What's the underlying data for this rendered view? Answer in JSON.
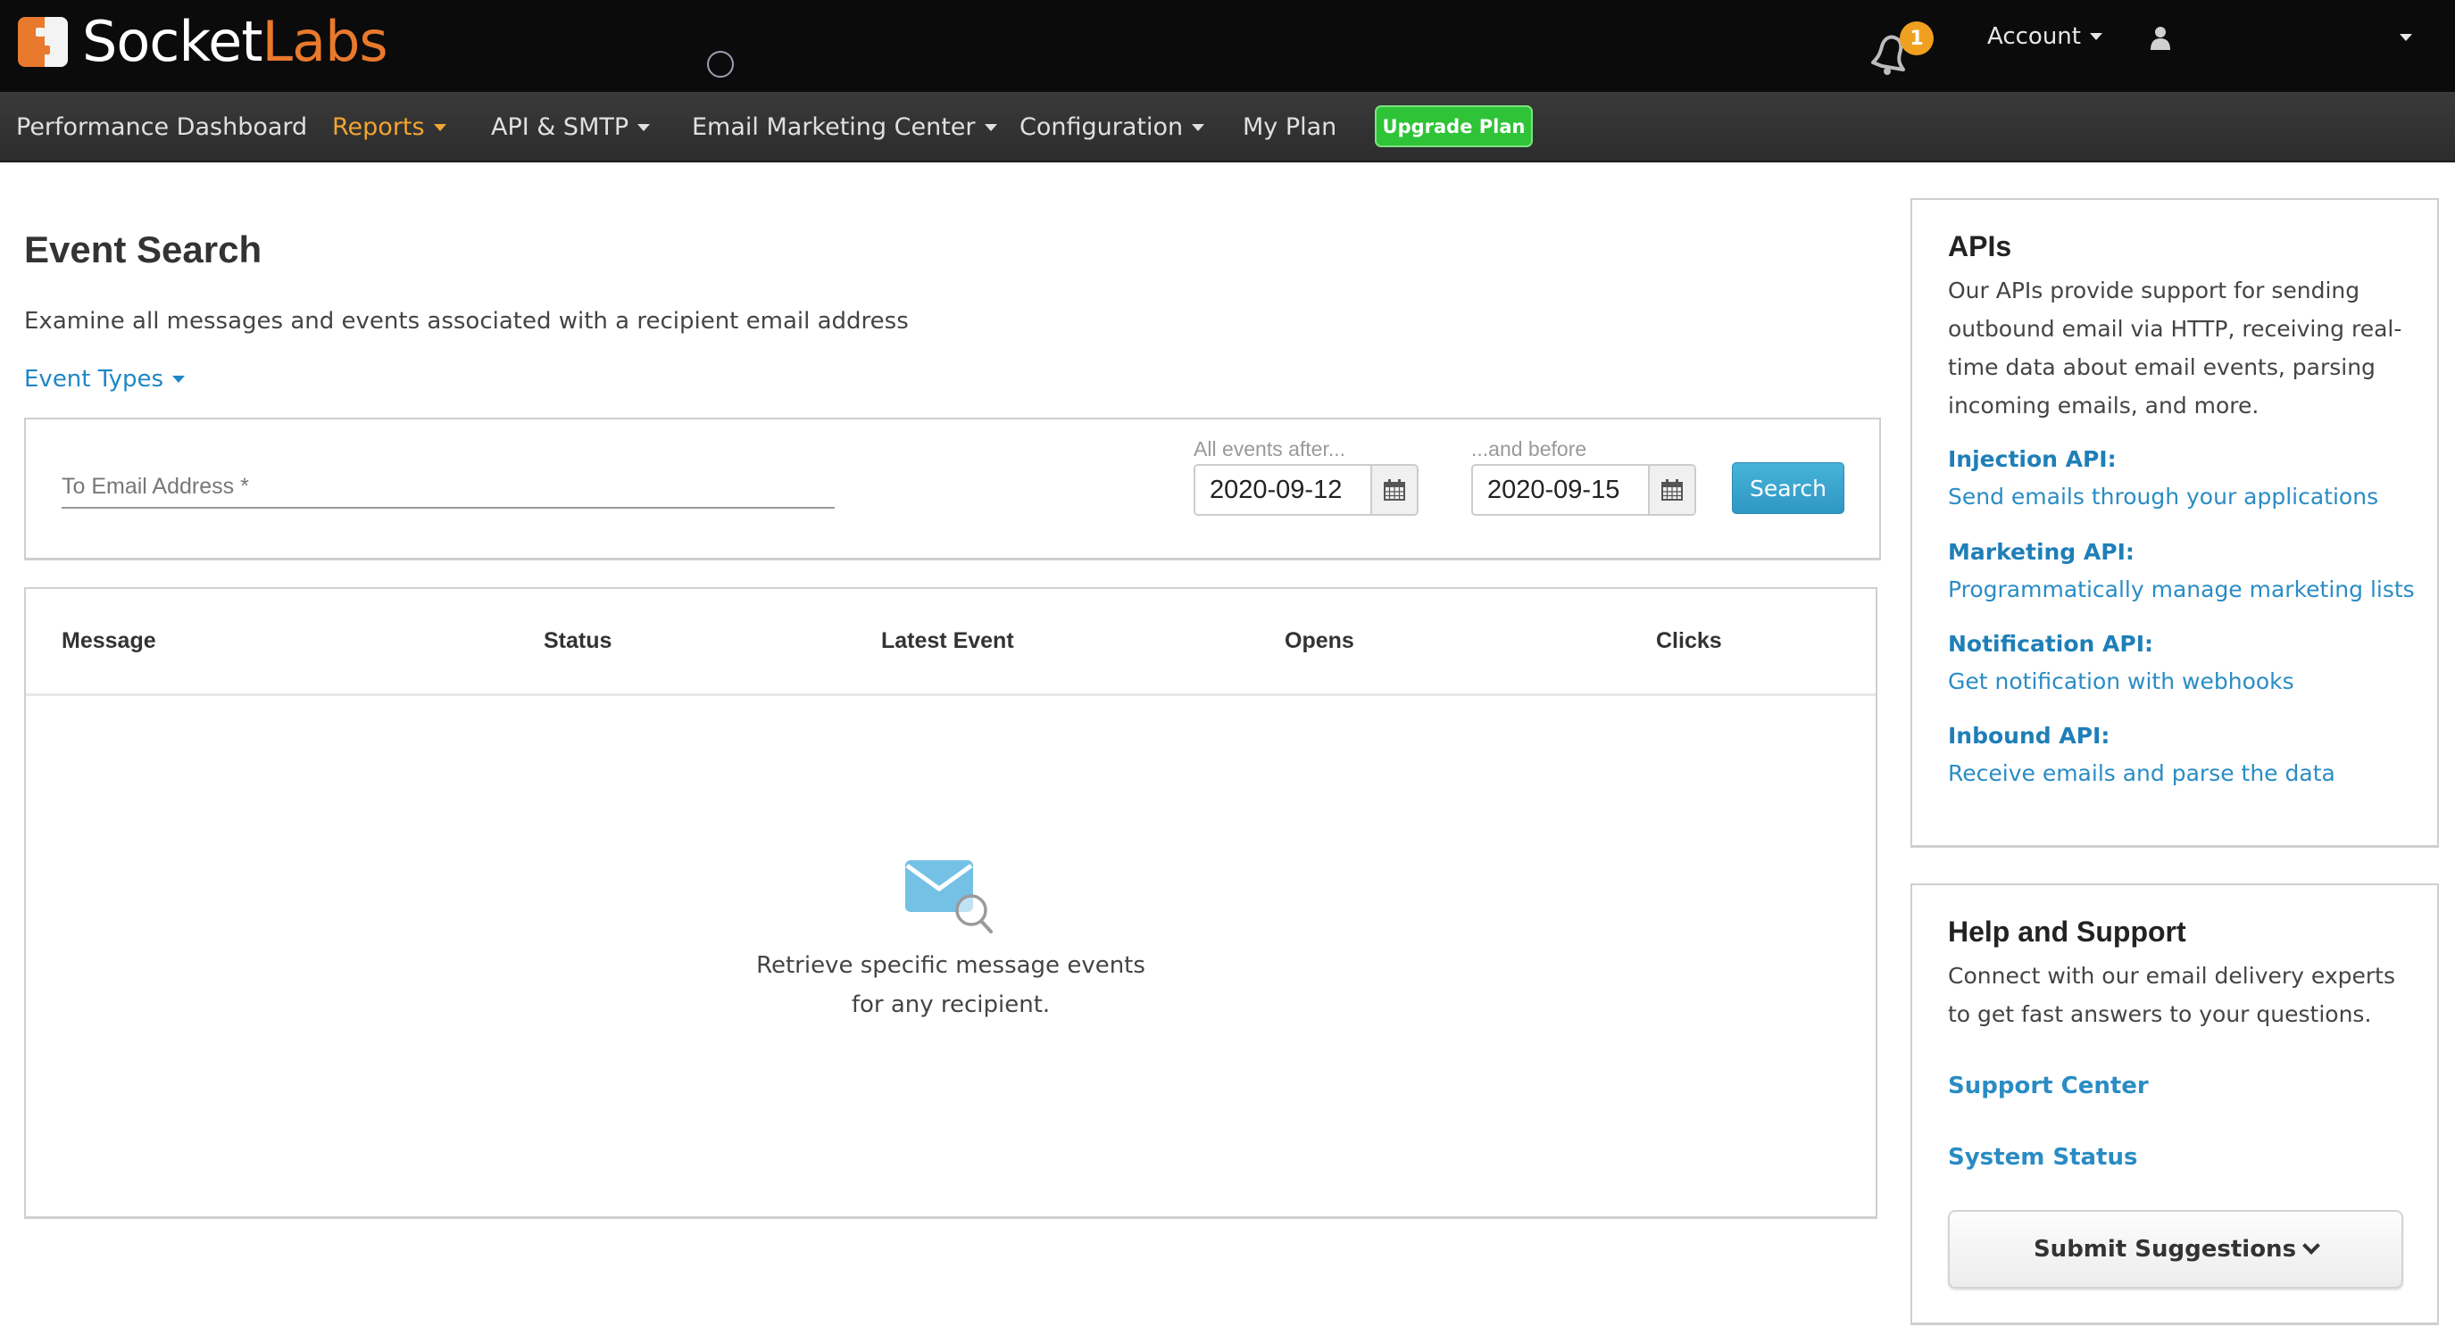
{
  "header": {
    "logo_primary": "Socket",
    "logo_secondary": "Labs",
    "notifications_count": "1",
    "account_label": "Account",
    "user_icon": "user-icon",
    "bell_icon": "bell-icon"
  },
  "nav": {
    "items": [
      {
        "label": "Performance Dashboard",
        "has_dropdown": false,
        "active": false
      },
      {
        "label": "Reports",
        "has_dropdown": true,
        "active": true
      },
      {
        "label": "API & SMTP",
        "has_dropdown": true,
        "active": false
      },
      {
        "label": "Email Marketing Center",
        "has_dropdown": true,
        "active": false
      },
      {
        "label": "Configuration",
        "has_dropdown": true,
        "active": false
      },
      {
        "label": "My Plan",
        "has_dropdown": false,
        "active": false
      }
    ],
    "upgrade_label": "Upgrade Plan"
  },
  "main": {
    "title": "Event Search",
    "description": "Examine all messages and events associated with a recipient email address",
    "event_types_label": "Event Types",
    "search": {
      "email_placeholder": "To Email Address *",
      "email_value": "",
      "after_label": "All events after...",
      "after_value": "2020-09-12",
      "before_label": "...and before",
      "before_value": "2020-09-15",
      "search_button": "Search"
    },
    "table": {
      "columns": [
        "Message",
        "Status",
        "Latest Event",
        "Opens",
        "Clicks"
      ],
      "rows": [],
      "empty_line1": "Retrieve specific message events",
      "empty_line2": "for any recipient."
    }
  },
  "sidebar": {
    "apis": {
      "title": "APIs",
      "description": "Our APIs provide support for sending outbound email via HTTP, receiving real-time data about email events, parsing incoming emails, and more.",
      "items": [
        {
          "heading": "Injection API:",
          "link": "Send emails through your applications"
        },
        {
          "heading": "Marketing API:",
          "link": "Programmatically manage marketing lists"
        },
        {
          "heading": "Notification API:",
          "link": "Get notification with webhooks"
        },
        {
          "heading": "Inbound API:",
          "link": "Receive emails and parse the data"
        }
      ]
    },
    "help": {
      "title": "Help and Support",
      "description": "Connect with our email delivery experts to get fast answers to your questions.",
      "links": [
        "Support Center",
        "System Status"
      ],
      "suggest_button": "Submit Suggestions"
    }
  },
  "colors": {
    "brand_orange": "#e8792d",
    "active_nav": "#f3a531",
    "upgrade_green": "#2fc338",
    "link_blue": "#2a8cc4",
    "search_button": "#3aa5ce",
    "badge": "#f0a020"
  }
}
